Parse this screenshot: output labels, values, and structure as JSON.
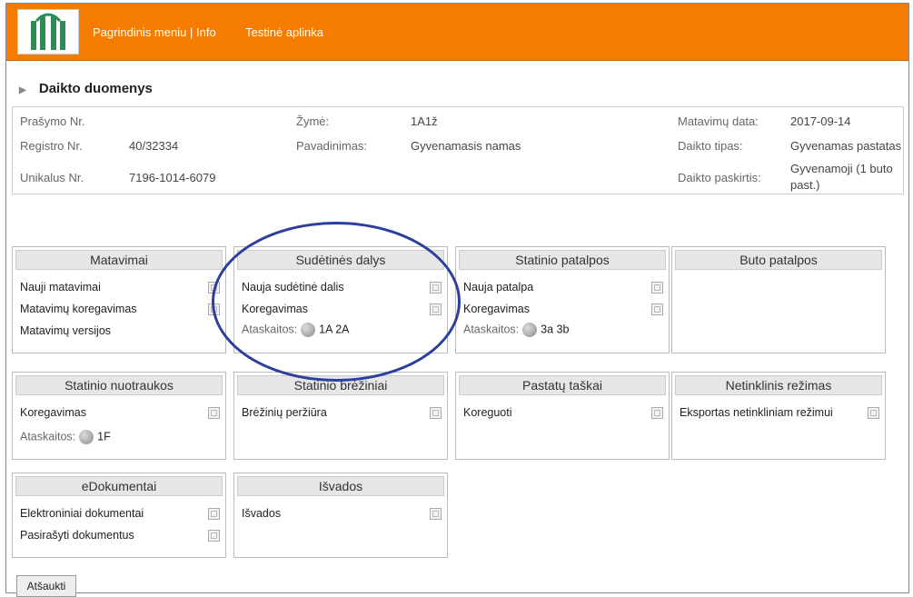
{
  "nav": {
    "main_menu": "Pagrindinis meniu",
    "info": "Info",
    "separator": "|",
    "env": "Testinė aplinka"
  },
  "section": {
    "title": "Daikto duomenys"
  },
  "details": {
    "request_no_label": "Prašymo Nr.",
    "request_no_value": "",
    "registry_label": "Registro Nr.",
    "registry_value": "40/32334",
    "unique_label": "Unikalus Nr.",
    "unique_value": "7196-1014-6079",
    "mark_label": "Žymė:",
    "mark_value": "1A1ž",
    "name_label": "Pavadinimas:",
    "name_value": "Gyvenamasis namas",
    "meas_date_label": "Matavimų data:",
    "meas_date_value": "2017-09-14",
    "type_label": "Daikto tipas:",
    "type_value": "Gyvenamas pastatas",
    "purpose_label": "Daikto paskirtis:",
    "purpose_value_1": "Gyvenamoji (1 buto",
    "purpose_value_2": "past.)"
  },
  "panels": {
    "matavimai": {
      "title": "Matavimai",
      "items": [
        "Nauji matavimai",
        "Matavimų koregavimas",
        "Matavimų versijos"
      ]
    },
    "sudetines": {
      "title": "Sudėtinės dalys",
      "items": [
        "Nauja sudėtinė dalis",
        "Koregavimas"
      ],
      "reports_label": "Ataskaitos:",
      "reports_codes": "1A 2A"
    },
    "patalpos": {
      "title": "Statinio patalpos",
      "items": [
        "Nauja patalpa",
        "Koregavimas"
      ],
      "reports_label": "Ataskaitos:",
      "reports_codes": "3a 3b"
    },
    "buto": {
      "title": "Buto patalpos"
    },
    "nuotraukos": {
      "title": "Statinio nuotraukos",
      "items": [
        "Koregavimas"
      ],
      "reports_label": "Ataskaitos:",
      "reports_codes": "1F"
    },
    "breziniai": {
      "title": "Statinio brėžiniai",
      "items": [
        "Brėžinių peržiūra"
      ]
    },
    "taskai": {
      "title": "Pastatų taškai",
      "items": [
        "Koreguoti"
      ]
    },
    "netinklinis": {
      "title": "Netinklinis režimas",
      "items": [
        "Eksportas netinkliniam režimui"
      ]
    },
    "edokumentai": {
      "title": "eDokumentai",
      "items": [
        "Elektroniniai dokumentai",
        "Pasirašyti dokumentus"
      ]
    },
    "isvados": {
      "title": "Išvados",
      "items": [
        "Išvados"
      ]
    }
  },
  "cancel_button": "Atšaukti",
  "colors": {
    "topbar": "#f57c00",
    "annotation_ellipse": "#2c3f9c"
  },
  "icons": {
    "logo": "building-logo-icon",
    "edit": "edit-icon",
    "report": "report-disc-icon",
    "section_arrow": "triangle-right-icon"
  }
}
